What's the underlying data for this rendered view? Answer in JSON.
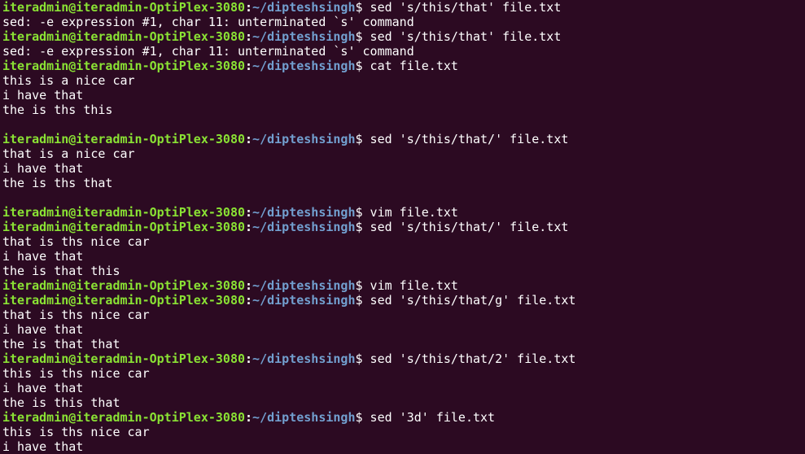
{
  "terminal": {
    "colors": {
      "background": "#2c0a22",
      "text": "#ffffff",
      "user_host": "#8ae234",
      "path": "#729fcf"
    },
    "lines": [
      {
        "type": "prompt",
        "user": "iteradmin@iteradmin-OptiPlex-3080",
        "path": "~/dipteshsingh",
        "cmd": "sed 's/this/that' file.txt"
      },
      {
        "type": "output",
        "text": "sed: -e expression #1, char 11: unterminated `s' command"
      },
      {
        "type": "prompt",
        "user": "iteradmin@iteradmin-OptiPlex-3080",
        "path": "~/dipteshsingh",
        "cmd": "sed 's/this/that' file.txt"
      },
      {
        "type": "output",
        "text": "sed: -e expression #1, char 11: unterminated `s' command"
      },
      {
        "type": "prompt",
        "user": "iteradmin@iteradmin-OptiPlex-3080",
        "path": "~/dipteshsingh",
        "cmd": "cat file.txt"
      },
      {
        "type": "output",
        "text": "this is a nice car"
      },
      {
        "type": "output",
        "text": "i have that"
      },
      {
        "type": "output",
        "text": "the is ths this"
      },
      {
        "type": "output",
        "text": ""
      },
      {
        "type": "prompt",
        "user": "iteradmin@iteradmin-OptiPlex-3080",
        "path": "~/dipteshsingh",
        "cmd": "sed 's/this/that/' file.txt"
      },
      {
        "type": "output",
        "text": "that is a nice car"
      },
      {
        "type": "output",
        "text": "i have that"
      },
      {
        "type": "output",
        "text": "the is ths that"
      },
      {
        "type": "output",
        "text": ""
      },
      {
        "type": "prompt",
        "user": "iteradmin@iteradmin-OptiPlex-3080",
        "path": "~/dipteshsingh",
        "cmd": "vim file.txt"
      },
      {
        "type": "prompt",
        "user": "iteradmin@iteradmin-OptiPlex-3080",
        "path": "~/dipteshsingh",
        "cmd": "sed 's/this/that/' file.txt"
      },
      {
        "type": "output",
        "text": "that is ths nice car"
      },
      {
        "type": "output",
        "text": "i have that"
      },
      {
        "type": "output",
        "text": "the is that this"
      },
      {
        "type": "prompt",
        "user": "iteradmin@iteradmin-OptiPlex-3080",
        "path": "~/dipteshsingh",
        "cmd": "vim file.txt"
      },
      {
        "type": "prompt",
        "user": "iteradmin@iteradmin-OptiPlex-3080",
        "path": "~/dipteshsingh",
        "cmd": "sed 's/this/that/g' file.txt"
      },
      {
        "type": "output",
        "text": "that is ths nice car"
      },
      {
        "type": "output",
        "text": "i have that"
      },
      {
        "type": "output",
        "text": "the is that that"
      },
      {
        "type": "prompt",
        "user": "iteradmin@iteradmin-OptiPlex-3080",
        "path": "~/dipteshsingh",
        "cmd": "sed 's/this/that/2' file.txt"
      },
      {
        "type": "output",
        "text": "this is ths nice car"
      },
      {
        "type": "output",
        "text": "i have that"
      },
      {
        "type": "output",
        "text": "the is this that"
      },
      {
        "type": "prompt",
        "user": "iteradmin@iteradmin-OptiPlex-3080",
        "path": "~/dipteshsingh",
        "cmd": "sed '3d' file.txt"
      },
      {
        "type": "output",
        "text": "this is ths nice car"
      },
      {
        "type": "output",
        "text": "i have that"
      }
    ]
  }
}
